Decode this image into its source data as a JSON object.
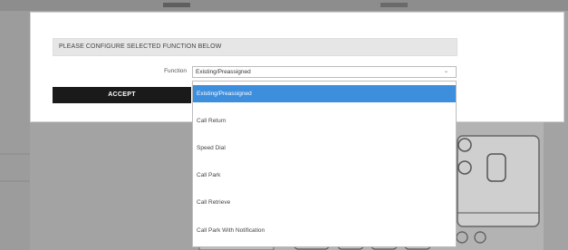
{
  "modal": {
    "header": "PLEASE CONFIGURE SELECTED FUNCTION BELOW",
    "function_label": "Function",
    "select_value": "Existing/Preassigned",
    "accept_label": "ACCEPT"
  },
  "dropdown": {
    "options": [
      "Existing/Preassigned",
      "Call Return",
      "Speed Dial",
      "Call Park",
      "Call Retrieve",
      "Call Park With Notification"
    ],
    "selected_index": 0
  },
  "colors": {
    "selected_option": "#3d8edc",
    "accept_button": "#1a1a1a",
    "callout_line": "#4a6a1a"
  },
  "icons": [
    "chevron-down-icon"
  ]
}
